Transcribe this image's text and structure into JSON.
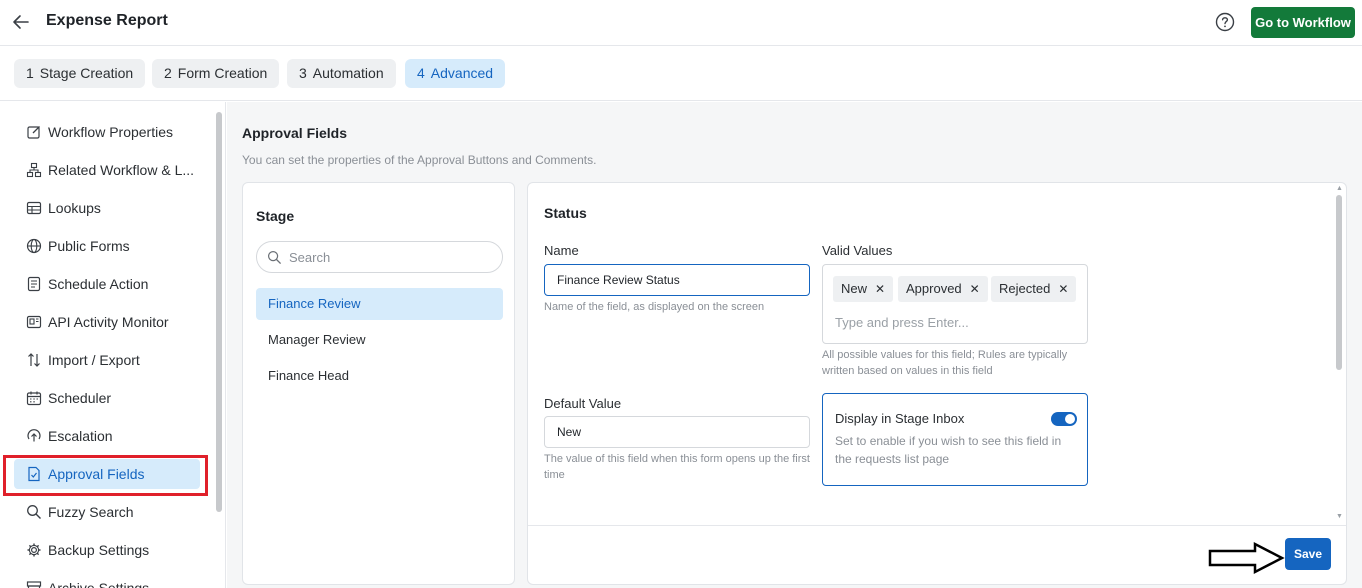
{
  "header": {
    "title": "Expense Report",
    "go_to_workflow_label": "Go to Workflow"
  },
  "steps": [
    {
      "num": "1",
      "label": "Stage Creation"
    },
    {
      "num": "2",
      "label": "Form Creation"
    },
    {
      "num": "3",
      "label": "Automation"
    },
    {
      "num": "4",
      "label": "Advanced"
    }
  ],
  "sidebar": {
    "items": [
      {
        "label": "Workflow Properties",
        "icon": "edit-icon"
      },
      {
        "label": "Related Workflow & L...",
        "icon": "hierarchy-icon"
      },
      {
        "label": "Lookups",
        "icon": "table-icon"
      },
      {
        "label": "Public Forms",
        "icon": "globe-icon"
      },
      {
        "label": "Schedule Action",
        "icon": "document-list-icon"
      },
      {
        "label": "API Activity Monitor",
        "icon": "api-monitor-icon"
      },
      {
        "label": "Import / Export",
        "icon": "swap-arrows-icon"
      },
      {
        "label": "Scheduler",
        "icon": "calendar-icon"
      },
      {
        "label": "Escalation",
        "icon": "escalation-icon"
      },
      {
        "label": "Approval Fields",
        "icon": "approval-document-icon"
      },
      {
        "label": "Fuzzy Search",
        "icon": "search-icon"
      },
      {
        "label": "Backup Settings",
        "icon": "gear-icon"
      },
      {
        "label": "Archive Settings",
        "icon": "archive-icon"
      }
    ],
    "active_index": 9
  },
  "main": {
    "title": "Approval Fields",
    "subtitle": "You can set the properties of the Approval Buttons and Comments.",
    "stage_panel": {
      "title": "Stage",
      "search_placeholder": "Search",
      "stages": [
        "Finance Review",
        "Manager Review",
        "Finance Head"
      ],
      "active_index": 0
    },
    "detail": {
      "title": "Status",
      "name_label": "Name",
      "name_value": "Finance Review Status",
      "name_hint": "Name of the field, as displayed on the screen",
      "valid_values_label": "Valid Values",
      "valid_values": [
        "New",
        "Approved",
        "Rejected"
      ],
      "valid_values_placeholder": "Type and press Enter...",
      "valid_values_hint": "All possible values for this field; Rules are typically written based on values in this field",
      "default_label": "Default Value",
      "default_value": "New",
      "default_hint": "The value of this field when this form opens up the first time",
      "inbox_title": "Display in Stage Inbox",
      "inbox_desc": "Set to enable if you wish to see this field in the requests list page",
      "inbox_enabled": true,
      "save_label": "Save"
    }
  },
  "colors": {
    "primary": "#1565c0",
    "go_button": "#137a3a",
    "highlight": "#e0202a",
    "active_bg": "#d6ebfb"
  }
}
